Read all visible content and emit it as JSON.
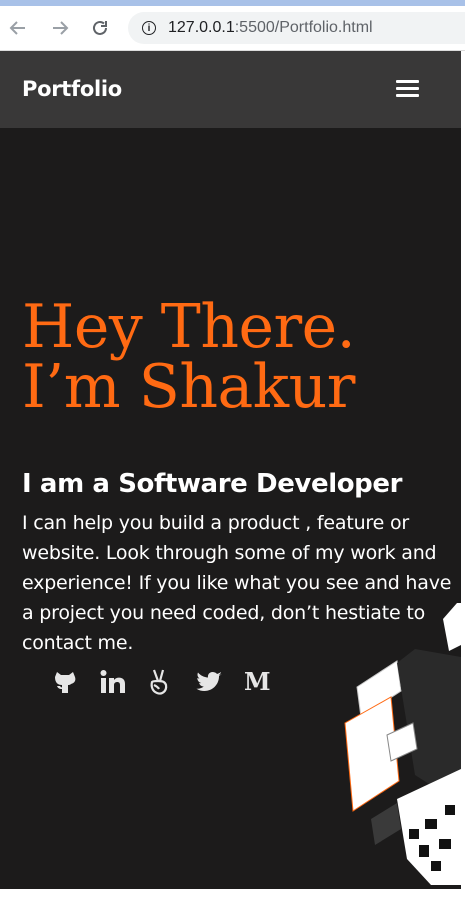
{
  "browser": {
    "url_host": "127.0.0.1",
    "url_rest": ":5500/Portfolio.html"
  },
  "navbar": {
    "brand": "Portfolio"
  },
  "hero": {
    "title_line1": "Hey There.",
    "title_line2": "I’m Shakur",
    "subtitle": "I am a Software Developer",
    "blurb": "I can help you build a product , feature or website. Look through some of my work and experience! If you like what you see and have a project you need coded, don’t hestiate to contact me."
  },
  "socials": [
    {
      "name": "github-icon"
    },
    {
      "name": "linkedin-icon"
    },
    {
      "name": "angellist-icon"
    },
    {
      "name": "twitter-icon"
    },
    {
      "name": "medium-icon",
      "glyph": "M"
    }
  ],
  "colors": {
    "accent": "#ff6a13",
    "page_bg": "#1c1b1b",
    "navbar_bg": "#393838"
  }
}
